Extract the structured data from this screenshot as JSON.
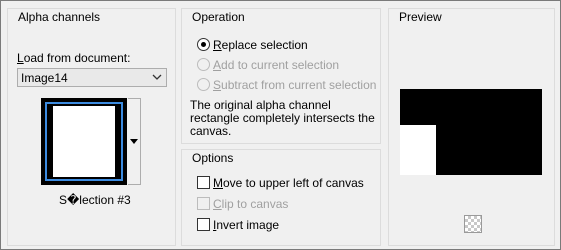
{
  "alpha_channels": {
    "title": "Alpha channels",
    "load_from_label": "Load from document:",
    "document_select": {
      "value": "Image14"
    },
    "selection_name": "S�lection #3"
  },
  "operation": {
    "title": "Operation",
    "options": [
      {
        "label": "Replace selection",
        "selected": true,
        "enabled": true
      },
      {
        "label": "Add to current selection",
        "selected": false,
        "enabled": false
      },
      {
        "label": "Subtract from current selection",
        "selected": false,
        "enabled": false
      }
    ],
    "description": [
      "The original alpha channel",
      "rectangle completely intersects the",
      "canvas."
    ]
  },
  "options": {
    "title": "Options",
    "items": [
      {
        "label": "Move to upper left of canvas",
        "checked": false,
        "enabled": true
      },
      {
        "label": "Clip to canvas",
        "checked": false,
        "enabled": false
      },
      {
        "label": "Invert image",
        "checked": false,
        "enabled": true
      }
    ]
  },
  "preview": {
    "title": "Preview"
  },
  "colors": {
    "selection_border": "#3c8be0",
    "window_bg": "#f0f0f0"
  }
}
